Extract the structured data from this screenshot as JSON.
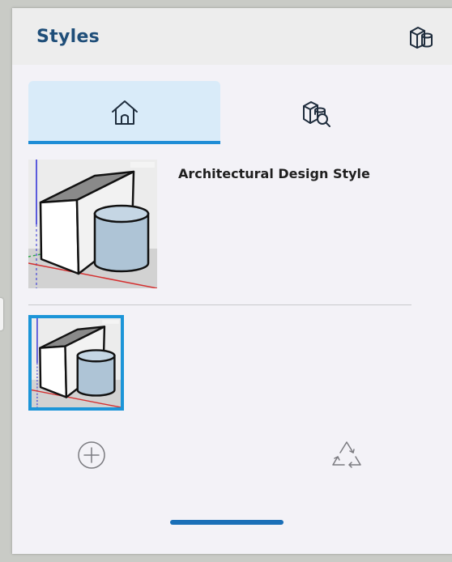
{
  "panel": {
    "title": "Styles",
    "header_icon": "styles-cube-cylinder-icon"
  },
  "tabs": [
    {
      "id": "in-model",
      "icon": "home-icon",
      "active": true
    },
    {
      "id": "browse",
      "icon": "style-search-icon",
      "active": false
    }
  ],
  "current_style": {
    "name": "Architectural Design Style",
    "thumbnail_icon": "style-preview-thumbnail"
  },
  "model_styles": [
    {
      "thumbnail_icon": "style-preview-thumbnail",
      "selected": true
    }
  ],
  "actions": {
    "add_icon": "add-circle-icon",
    "purge_icon": "recycle-icon"
  },
  "colors": {
    "title": "#1f4e79",
    "accent": "#1c95d8",
    "tab_active_bg": "#d9ebf9",
    "indicator": "#1a6fb7"
  }
}
